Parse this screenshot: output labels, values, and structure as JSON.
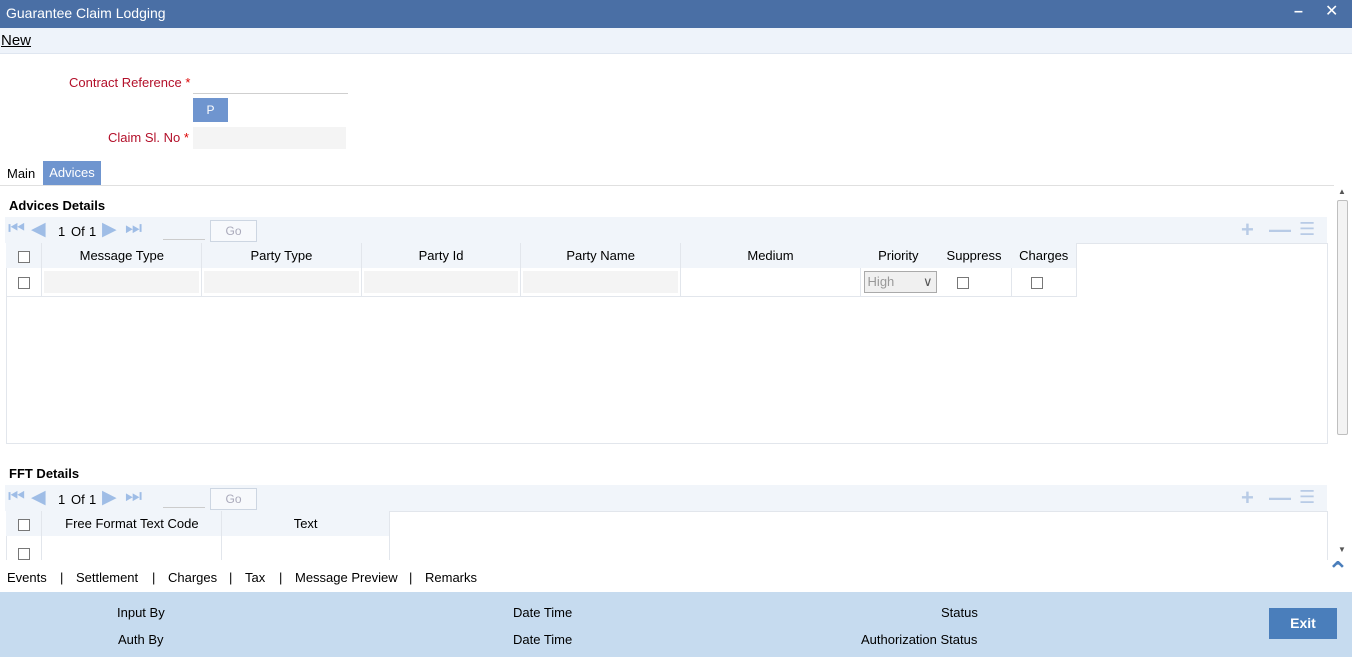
{
  "window": {
    "title": "Guarantee Claim Lodging",
    "minimize_glyph": "–",
    "close_glyph": "✕"
  },
  "menu": {
    "new_label": "New"
  },
  "form": {
    "contract_reference_label": "Contract Reference",
    "required_mark": "*",
    "p_button_label": "P",
    "claim_sl_no_label": "Claim Sl. No"
  },
  "tabs": [
    {
      "label": "Main",
      "active": false
    },
    {
      "label": "Advices",
      "active": true
    }
  ],
  "advices": {
    "title": "Advices Details",
    "pager": {
      "current": "1",
      "of_label": "Of",
      "total": "1",
      "go_label": "Go"
    },
    "columns": [
      "Message Type",
      "Party Type",
      "Party Id",
      "Party Name",
      "Medium",
      "Priority",
      "Suppress",
      "Charges"
    ],
    "rows": [
      {
        "message_type": "",
        "party_type": "",
        "party_id": "",
        "party_name": "",
        "medium": "",
        "priority": "High",
        "suppress": false,
        "charges": false
      }
    ]
  },
  "fft": {
    "title": "FFT Details",
    "pager": {
      "current": "1",
      "of_label": "Of",
      "total": "1",
      "go_label": "Go"
    },
    "columns": [
      "Free Format Text Code",
      "Text"
    ]
  },
  "footer_links": [
    "Events",
    "Settlement",
    "Charges",
    "Tax",
    "Message Preview",
    "Remarks"
  ],
  "footer_separator": "|",
  "status": {
    "input_by": "Input By",
    "date_time": "Date Time",
    "status": "Status",
    "auth_by": "Auth By",
    "date_time_2": "Date Time",
    "authorization_status": "Authorization Status",
    "exit_label": "Exit"
  },
  "colors": {
    "titlebar": "#4a6fa5",
    "accent": "#6f95cf",
    "status_bar": "#c6dbef",
    "required_label": "#b3102a"
  },
  "icons": [
    "minimize-icon",
    "close-icon",
    "first-page-icon",
    "prev-page-icon",
    "next-page-icon",
    "last-page-icon",
    "add-row-icon",
    "delete-row-icon",
    "single-view-icon",
    "collapse-up-icon"
  ]
}
